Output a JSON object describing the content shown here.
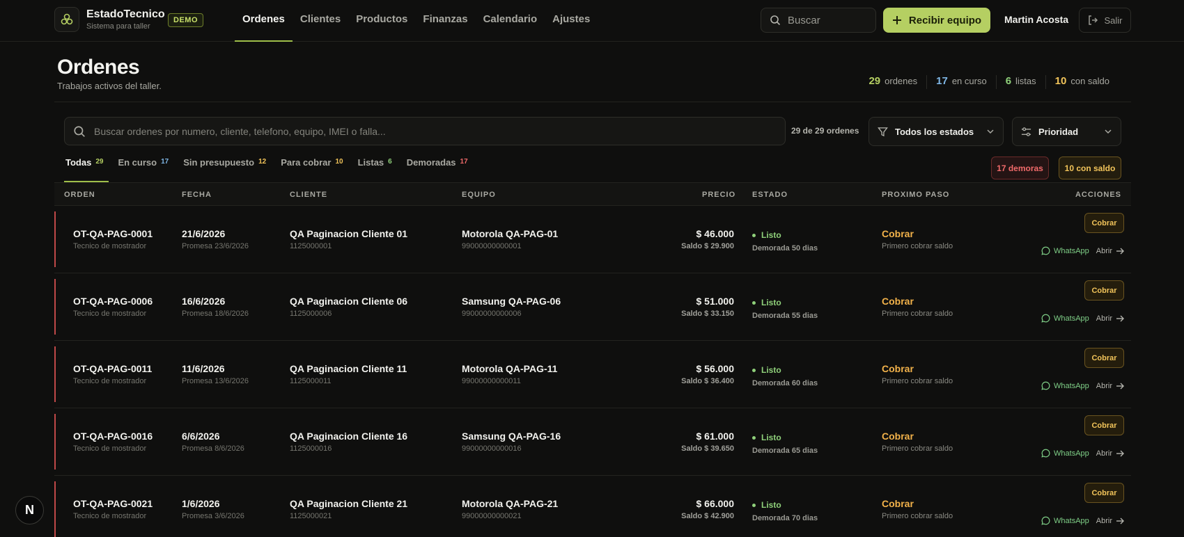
{
  "app": {
    "name": "EstadoTecnico",
    "subtitle": "Sistema para taller",
    "badge": "DEMO"
  },
  "nav": [
    {
      "label": "Ordenes",
      "active": true
    },
    {
      "label": "Clientes",
      "active": false
    },
    {
      "label": "Productos",
      "active": false
    },
    {
      "label": "Finanzas",
      "active": false
    },
    {
      "label": "Calendario",
      "active": false
    },
    {
      "label": "Ajustes",
      "active": false
    }
  ],
  "topbar": {
    "search_label": "Buscar",
    "receive_label": "Recibir equipo",
    "user": "Martin Acosta",
    "logout_label": "Salir"
  },
  "header": {
    "title": "Ordenes",
    "subtitle": "Trabajos activos del taller."
  },
  "stats": [
    {
      "num": "29",
      "label": "ordenes",
      "color": "#b5cf62"
    },
    {
      "num": "17",
      "label": "en curso",
      "color": "#7fb7e6"
    },
    {
      "num": "6",
      "label": "listas",
      "color": "#8fd07a"
    },
    {
      "num": "10",
      "label": "con saldo",
      "color": "#f2c45a"
    }
  ],
  "filters": {
    "search_placeholder": "Buscar ordenes por numero, cliente, telefono, equipo, IMEI o falla...",
    "count_text": "29 de 29 ordenes",
    "status_select": "Todos los estados",
    "priority_select": "Prioridad"
  },
  "tabs": [
    {
      "label": "Todas",
      "count": "29",
      "color": "#b5cf62",
      "active": true
    },
    {
      "label": "En curso",
      "count": "17",
      "color": "#7fb7e6",
      "active": false
    },
    {
      "label": "Sin presupuesto",
      "count": "12",
      "color": "#f2c45a",
      "active": false
    },
    {
      "label": "Para cobrar",
      "count": "10",
      "color": "#f2c45a",
      "active": false
    },
    {
      "label": "Listas",
      "count": "6",
      "color": "#8fd07a",
      "active": false
    },
    {
      "label": "Demoradas",
      "count": "17",
      "color": "#f06a6a",
      "active": false
    }
  ],
  "pills": {
    "delayed": "17 demoras",
    "balance": "10 con saldo"
  },
  "table": {
    "headers": {
      "order": "ORDEN",
      "date": "FECHA",
      "client": "CLIENTE",
      "device": "EQUIPO",
      "price": "PRECIO",
      "status": "ESTADO",
      "next": "PROXIMO PASO",
      "actions": "ACCIONES"
    },
    "rows": [
      {
        "order": "OT-QA-PAG-0001",
        "tech": "Tecnico de mostrador",
        "date": "21/6/2026",
        "promise": "Promesa 23/6/2026",
        "client": "QA Paginacion Cliente 01",
        "phone": "1125000001",
        "device": "Motorola QA-PAG-01",
        "imei": "99000000000001",
        "price": "$ 46.000",
        "balance": "Saldo $ 29.900",
        "status": "Listo",
        "delay": "Demorada 50 dias",
        "next": "Cobrar",
        "next_sub": "Primero cobrar saldo",
        "action": "Cobrar",
        "wa": "WhatsApp",
        "open": "Abrir"
      },
      {
        "order": "OT-QA-PAG-0006",
        "tech": "Tecnico de mostrador",
        "date": "16/6/2026",
        "promise": "Promesa 18/6/2026",
        "client": "QA Paginacion Cliente 06",
        "phone": "1125000006",
        "device": "Samsung QA-PAG-06",
        "imei": "99000000000006",
        "price": "$ 51.000",
        "balance": "Saldo $ 33.150",
        "status": "Listo",
        "delay": "Demorada 55 dias",
        "next": "Cobrar",
        "next_sub": "Primero cobrar saldo",
        "action": "Cobrar",
        "wa": "WhatsApp",
        "open": "Abrir"
      },
      {
        "order": "OT-QA-PAG-0011",
        "tech": "Tecnico de mostrador",
        "date": "11/6/2026",
        "promise": "Promesa 13/6/2026",
        "client": "QA Paginacion Cliente 11",
        "phone": "1125000011",
        "device": "Motorola QA-PAG-11",
        "imei": "99000000000011",
        "price": "$ 56.000",
        "balance": "Saldo $ 36.400",
        "status": "Listo",
        "delay": "Demorada 60 dias",
        "next": "Cobrar",
        "next_sub": "Primero cobrar saldo",
        "action": "Cobrar",
        "wa": "WhatsApp",
        "open": "Abrir"
      },
      {
        "order": "OT-QA-PAG-0016",
        "tech": "Tecnico de mostrador",
        "date": "6/6/2026",
        "promise": "Promesa 8/6/2026",
        "client": "QA Paginacion Cliente 16",
        "phone": "1125000016",
        "device": "Samsung QA-PAG-16",
        "imei": "99000000000016",
        "price": "$ 61.000",
        "balance": "Saldo $ 39.650",
        "status": "Listo",
        "delay": "Demorada 65 dias",
        "next": "Cobrar",
        "next_sub": "Primero cobrar saldo",
        "action": "Cobrar",
        "wa": "WhatsApp",
        "open": "Abrir"
      },
      {
        "order": "OT-QA-PAG-0021",
        "tech": "Tecnico de mostrador",
        "date": "1/6/2026",
        "promise": "Promesa 3/6/2026",
        "client": "QA Paginacion Cliente 21",
        "phone": "1125000021",
        "device": "Motorola QA-PAG-21",
        "imei": "99000000000021",
        "price": "$ 66.000",
        "balance": "Saldo $ 42.900",
        "status": "Listo",
        "delay": "Demorada 70 dias",
        "next": "Cobrar",
        "next_sub": "Primero cobrar saldo",
        "action": "Cobrar",
        "wa": "WhatsApp",
        "open": "Abrir"
      }
    ]
  },
  "fab": {
    "label": "N"
  }
}
